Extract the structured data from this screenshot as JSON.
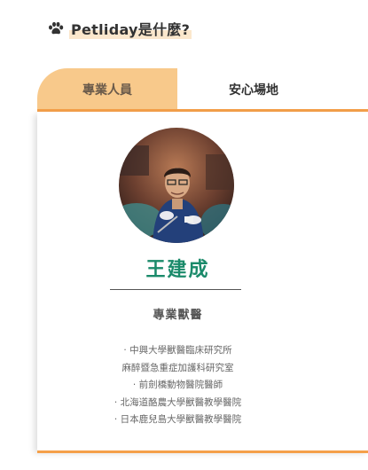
{
  "header": {
    "icon": "paw-icon",
    "title": "Petliday是什麼?"
  },
  "tabs": [
    {
      "label": "專業人員",
      "active": true
    },
    {
      "label": "安心場地",
      "active": false
    }
  ],
  "profile": {
    "name": "王建成",
    "role": "專業獸醫",
    "credentials": [
      "· 中興大學獸醫臨床研究所",
      "麻醉暨急重症加護科研究室",
      "· 前劍橋動物醫院醫師",
      "· 北海道酪農大學獸醫教學醫院",
      "· 日本鹿兒島大學獸醫教學醫院"
    ]
  },
  "colors": {
    "accent": "#f5a04a",
    "tab_active_bg": "#f8c98b",
    "name": "#1a8a6a"
  }
}
